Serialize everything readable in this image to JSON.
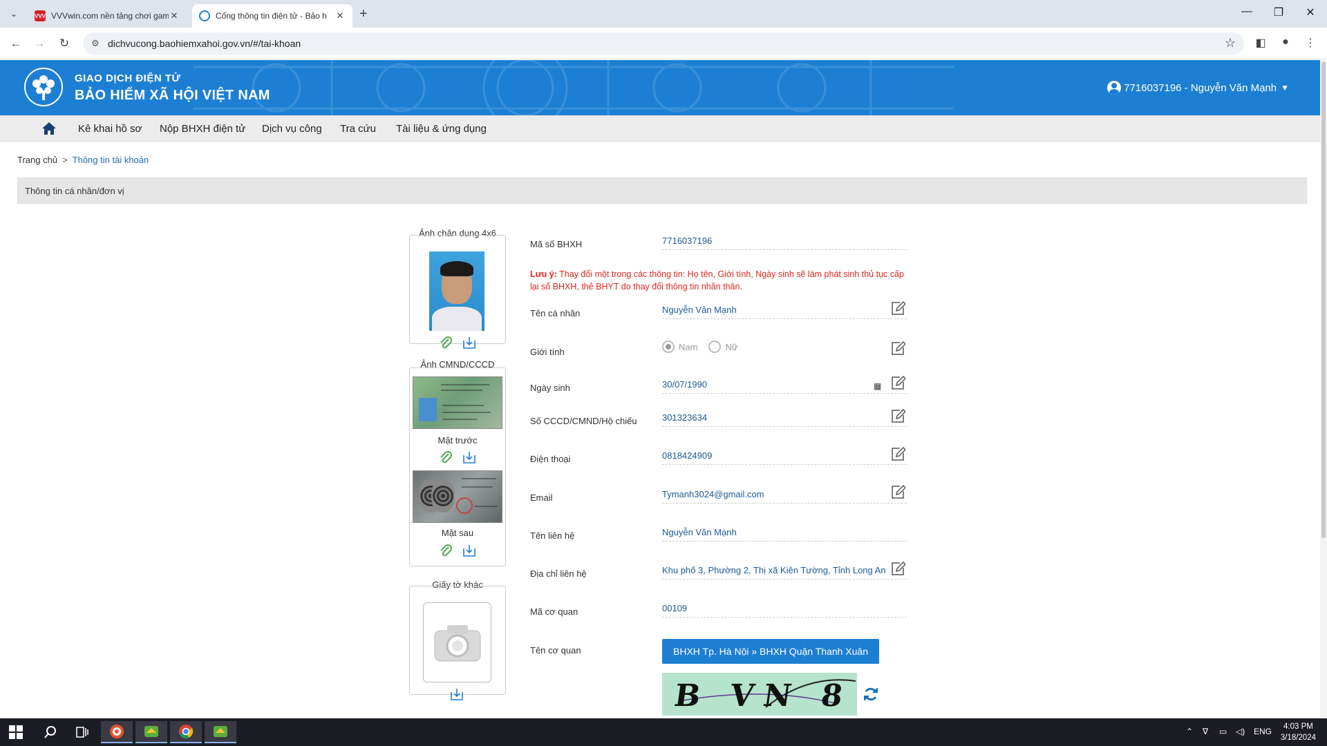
{
  "browser": {
    "tabs": [
      {
        "title": "VVVwin.com nền tảng chơi gam",
        "active": false
      },
      {
        "title": "Cổng thông tin điện tử - Bảo h",
        "active": true
      }
    ],
    "url": "dichvucong.baohiemxahoi.gov.vn/#/tai-khoan"
  },
  "header": {
    "brand_line1": "GIAO DỊCH ĐIỆN TỬ",
    "brand_line2": "BẢO HIỂM XÃ HỘI VIỆT NAM",
    "logo_ring_text": "BẢO HIỂM XÃ HỘI VIỆT NAM",
    "user": "7716037196 - Nguyễn Văn Mạnh",
    "color": "#1d7fd3"
  },
  "nav": {
    "items": [
      "Kê khai hồ sơ",
      "Nộp BHXH điện tử",
      "Dịch vụ công",
      "Tra cứu",
      "Tài liệu & ứng dụng"
    ]
  },
  "breadcrumb": {
    "home": "Trang chủ",
    "separator": ">",
    "current": "Thông tin tài khoản"
  },
  "section_title": "Thông tin cá nhân/đơn vị",
  "photos": {
    "portrait_label": "Ảnh chân dung 4x6",
    "id_label": "Ảnh CMND/CCCD",
    "front_label": "Mặt trước",
    "back_label": "Mặt sau",
    "other_label": "Giấy tờ khác"
  },
  "form": {
    "bhxh_label": "Mã số BHXH",
    "bhxh_value": "7716037196",
    "warning_bold": "Lưu ý:",
    "warning_text": " Thay đổi một trong các thông tin: Họ tên, Giới tính, Ngày sinh sẽ làm phát sinh thủ tục cấp lại sổ BHXH, thẻ BHYT do thay đổi thông tin nhân thân.",
    "name_label": "Tên cá nhân",
    "name_value": "Nguyễn Văn Mạnh",
    "gender_label": "Giới tính",
    "gender_male": "Nam",
    "gender_female": "Nữ",
    "gender_selected": "Nam",
    "dob_label": "Ngày sinh",
    "dob_value": "30/07/1990",
    "id_label": "Số CCCD/CMND/Hộ chiếu",
    "id_value": "301323634",
    "phone_label": "Điện thoại",
    "phone_value": "0818424909",
    "email_label": "Email",
    "email_value": "Tymanh3024@gmail.com",
    "contact_label": "Tên liên hệ",
    "contact_value": "Nguyễn Văn Mạnh",
    "address_label": "Địa chỉ liên hệ",
    "address_value": "Khu phố 3, Phường 2, Thị xã Kiên Tường, Tỉnh Long An",
    "org_code_label": "Mã cơ quan",
    "org_code_value": "00109",
    "org_name_label": "Tên cơ quan",
    "org_name_value": "BHXH Tp. Hà Nội » BHXH Quận Thanh Xuân",
    "captcha_text": "B VN 8"
  },
  "taskbar": {
    "language": "ENG",
    "time": "4:03 PM",
    "date": "3/18/2024"
  }
}
